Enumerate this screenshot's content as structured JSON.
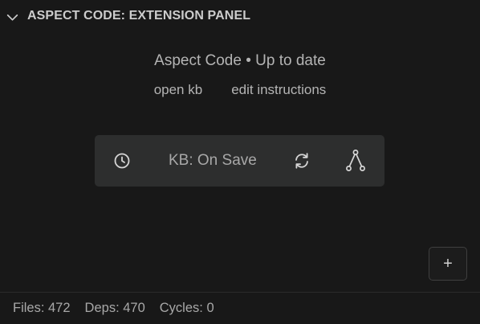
{
  "header": {
    "title": "ASPECT CODE: EXTENSION PANEL",
    "chevron_icon": "chevron-down-icon"
  },
  "status": {
    "text": "Aspect Code • Up to date"
  },
  "links": {
    "open_kb": "open kb",
    "edit_instructions": "edit instructions"
  },
  "toolbar": {
    "history_icon": "clock-icon",
    "mode_label": "KB: On Save",
    "refresh_icon": "refresh-icon",
    "graph_icon": "graph-icon"
  },
  "add_button": {
    "label": "+"
  },
  "footer": {
    "files": "Files: 472",
    "deps": "Deps: 470",
    "cycles": "Cycles: 0"
  },
  "colors": {
    "background": "#181818",
    "toolbar_bg": "#2d2e2e",
    "text": "#cccccc",
    "muted_text": "#a8a8a8"
  }
}
